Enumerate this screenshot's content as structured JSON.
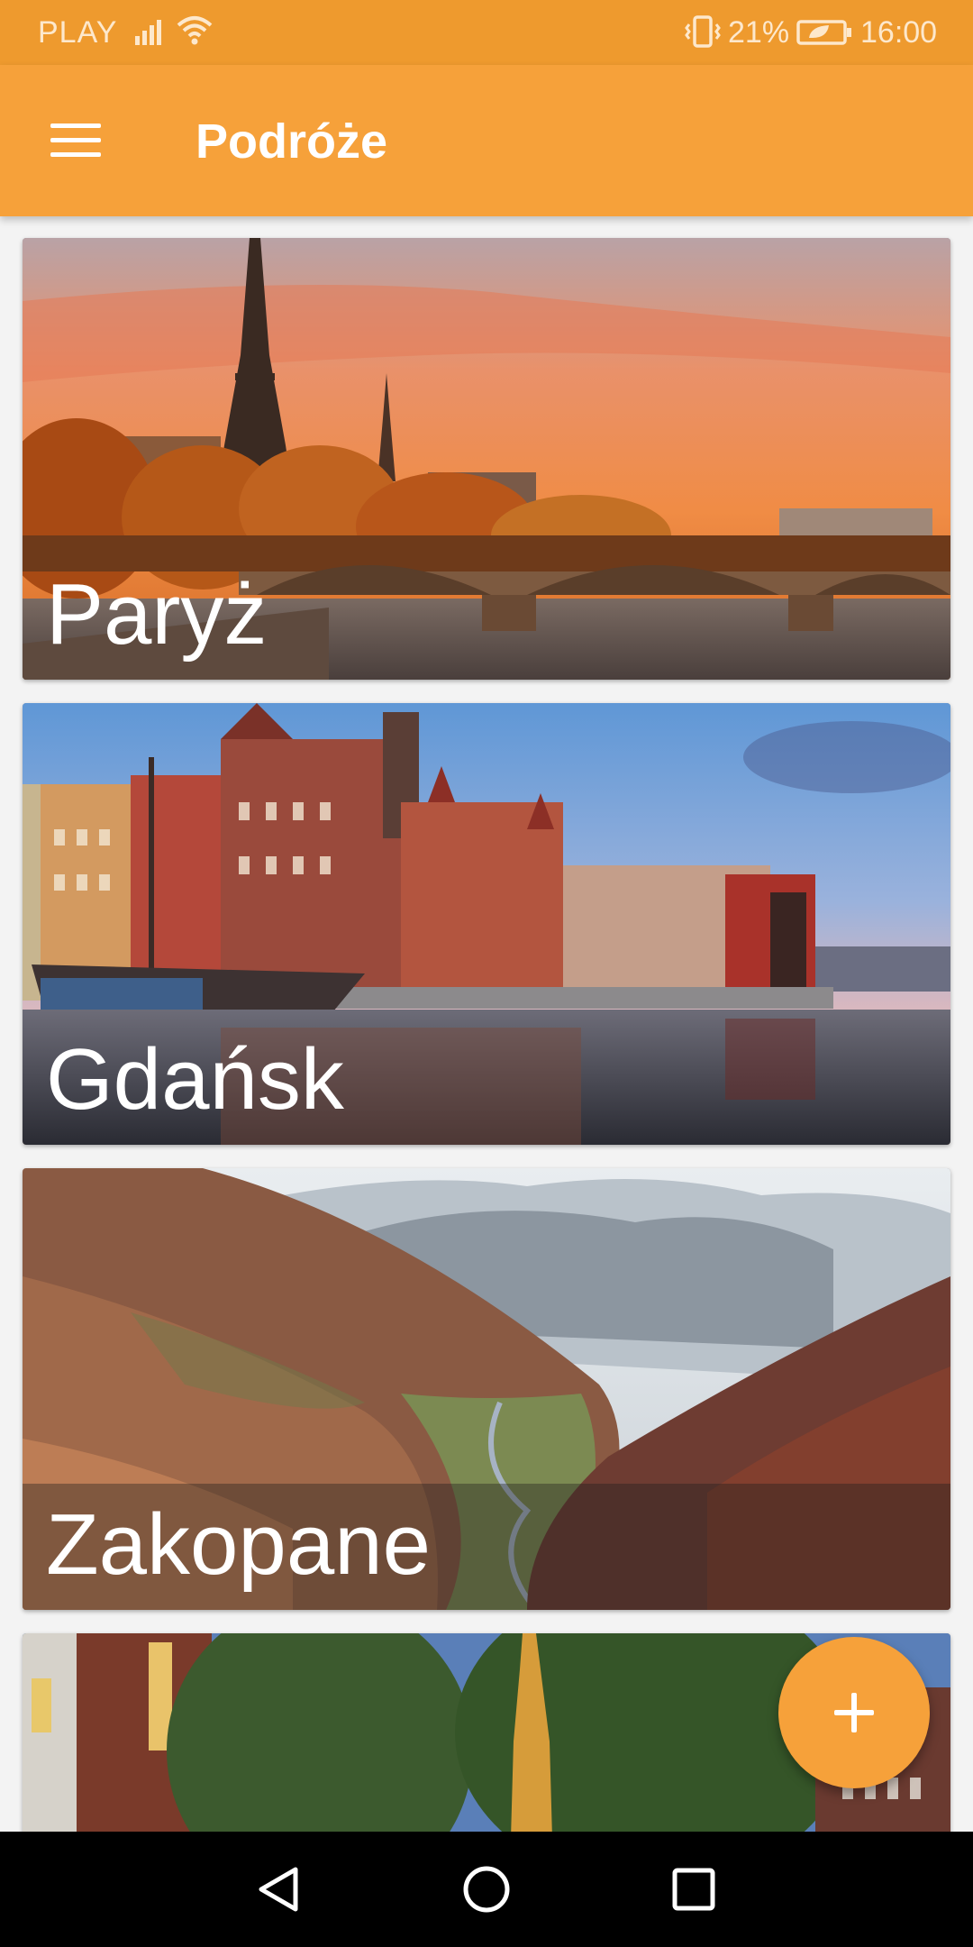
{
  "status_bar": {
    "carrier": "PLAY",
    "battery_percent": "21%",
    "time": "16:00",
    "icons": [
      "signal-icon",
      "wifi-icon",
      "vibrate-icon",
      "battery-saver-icon"
    ]
  },
  "app_bar": {
    "title": "Podróże",
    "menu_icon": "hamburger-menu-icon"
  },
  "destinations": [
    {
      "name": "Paryż"
    },
    {
      "name": "Gdańsk"
    },
    {
      "name": "Zakopane"
    },
    {
      "name": ""
    }
  ],
  "fab": {
    "icon": "plus-icon"
  },
  "nav_bar": {
    "icons": [
      "back-icon",
      "home-icon",
      "recents-icon"
    ]
  },
  "colors": {
    "primary": "#f6a13a",
    "primary_dark": "#ee9a2e",
    "text_on_primary": "#ffffff"
  }
}
